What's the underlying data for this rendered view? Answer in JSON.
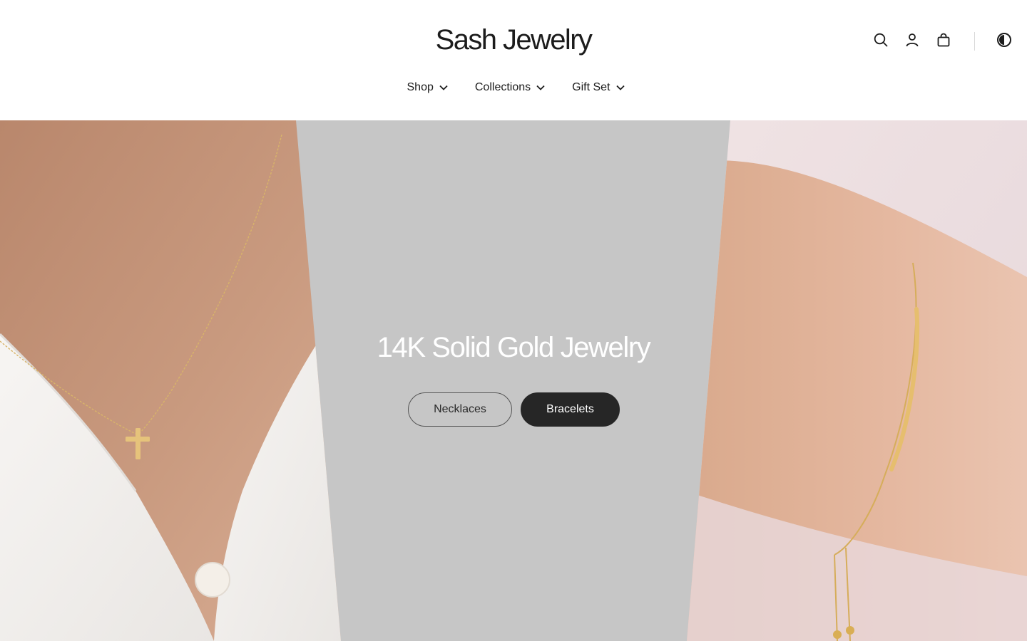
{
  "header": {
    "logo": "Sash Jewelry",
    "icons": [
      "search-icon",
      "account-icon",
      "cart-icon",
      "theme-toggle-icon"
    ],
    "nav": [
      {
        "label": "Shop"
      },
      {
        "label": "Collections"
      },
      {
        "label": "Gift Set"
      }
    ]
  },
  "hero": {
    "title": "14K Solid Gold Jewelry",
    "buttons": {
      "necklaces": "Necklaces",
      "bracelets": "Bracelets"
    },
    "images": {
      "left": "necklace-photo",
      "right": "bracelet-photo"
    }
  },
  "colors": {
    "background": "#ffffff",
    "hero_panel": "#c6c6c6",
    "text": "#1c1c1c",
    "button_dark": "#262626"
  }
}
